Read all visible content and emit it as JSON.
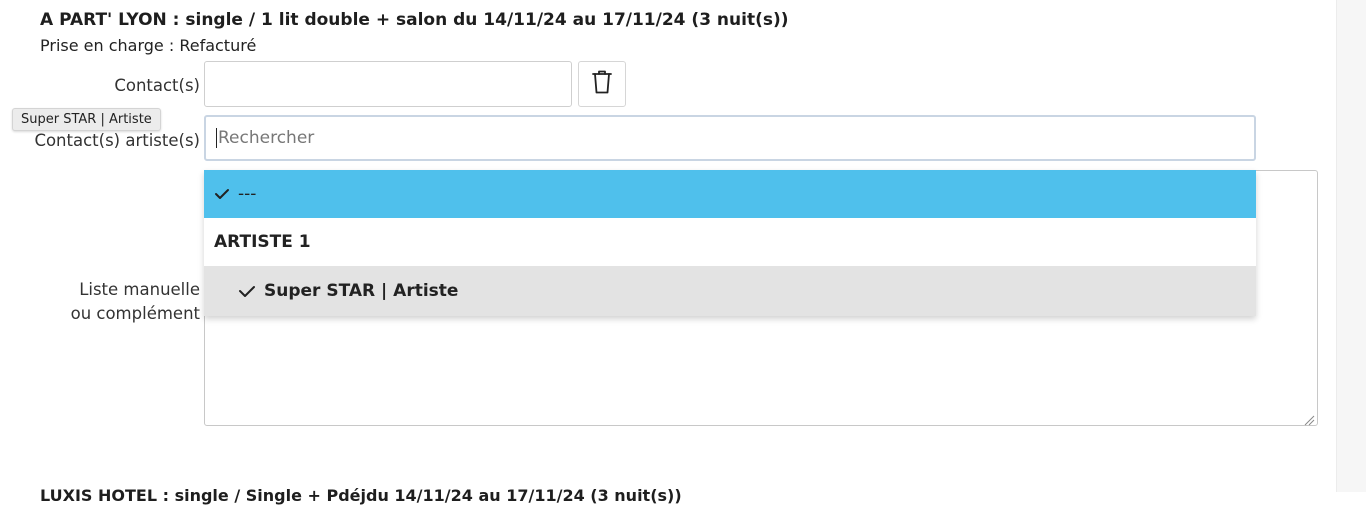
{
  "reservation": {
    "title": "A PART' LYON : single / 1 lit double + salon du 14/11/24 au 17/11/24 (3 nuit(s))",
    "billing": "Prise en charge : Refacturé"
  },
  "fields": {
    "contacts_label": "Contact(s)",
    "contacts_value": "",
    "artist_contacts_label": "Contact(s) artiste(s)",
    "manual_list_label_line1": "Liste manuelle",
    "manual_list_label_line2": "ou complément"
  },
  "tooltip": "Super STAR | Artiste",
  "search": {
    "placeholder": "Rechercher"
  },
  "dropdown": {
    "options": [
      {
        "label": "---",
        "selected": true,
        "type": "option"
      },
      {
        "label": "ARTISTE 1",
        "type": "group"
      },
      {
        "label": "Super STAR | Artiste",
        "checked": true,
        "type": "option"
      }
    ]
  },
  "next_reservation_title_partial": "LUXIS HOTEL : single / Single + Pdéjdu 14/11/24 au 17/11/24 (3 nuit(s))",
  "colors": {
    "selected_option_bg": "#4fc0ec",
    "hover_option_bg": "#e3e3e3",
    "search_border": "#c9d5e3"
  },
  "icons": {
    "delete": "trash-icon",
    "check": "check-icon",
    "resize": "resize-grip-icon"
  }
}
